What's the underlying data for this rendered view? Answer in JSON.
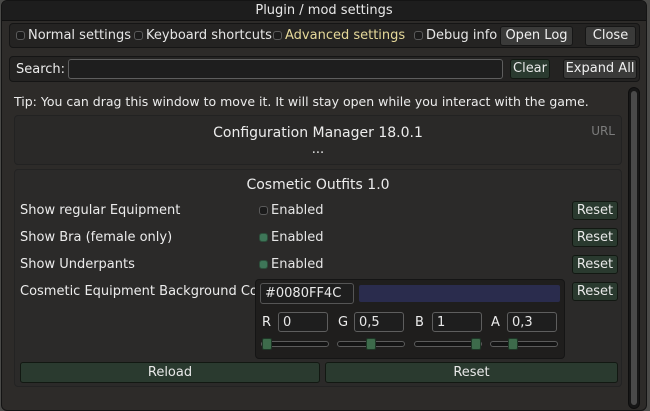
{
  "window": {
    "title": "Plugin / mod settings"
  },
  "toolbar": {
    "normal_label": "Normal settings",
    "keyboard_label": "Keyboard shortcuts",
    "advanced_label": "Advanced settings",
    "debug_label": "Debug info",
    "open_log_label": "Open Log",
    "close_label": "Close"
  },
  "search": {
    "label": "Search:",
    "value": "",
    "clear_label": "Clear",
    "expand_label": "Expand All"
  },
  "tip": "Tip: You can drag this window to move it. It will stay open while you interact with the game.",
  "config_manager": {
    "title": "Configuration Manager 18.0.1",
    "url_label": "URL",
    "ellipsis": "..."
  },
  "plugin": {
    "title": "Cosmetic Outfits 1.0",
    "settings": [
      {
        "label": "Show regular Equipment",
        "value_label": "Enabled",
        "checked": false,
        "reset_label": "Reset"
      },
      {
        "label": "Show Bra (female only)",
        "value_label": "Enabled",
        "checked": true,
        "reset_label": "Reset"
      },
      {
        "label": "Show Underpants",
        "value_label": "Enabled",
        "checked": true,
        "reset_label": "Reset"
      }
    ],
    "color_setting": {
      "label": "Cosmetic Equipment Background Color",
      "hex_value": "#0080FF4C",
      "swatch_color": "#2a2c4d",
      "reset_label": "Reset",
      "channels": [
        {
          "name": "R",
          "value": "0",
          "fraction": 0.0
        },
        {
          "name": "G",
          "value": "0,5",
          "fraction": 0.5
        },
        {
          "name": "B",
          "value": "1",
          "fraction": 1.0
        },
        {
          "name": "A",
          "value": "0,3",
          "fraction": 0.3
        }
      ]
    },
    "reload_label": "Reload",
    "reset_all_label": "Reset"
  },
  "colors": {
    "accent_green": "#3e7658",
    "advanced_text": "#e6d99a"
  }
}
